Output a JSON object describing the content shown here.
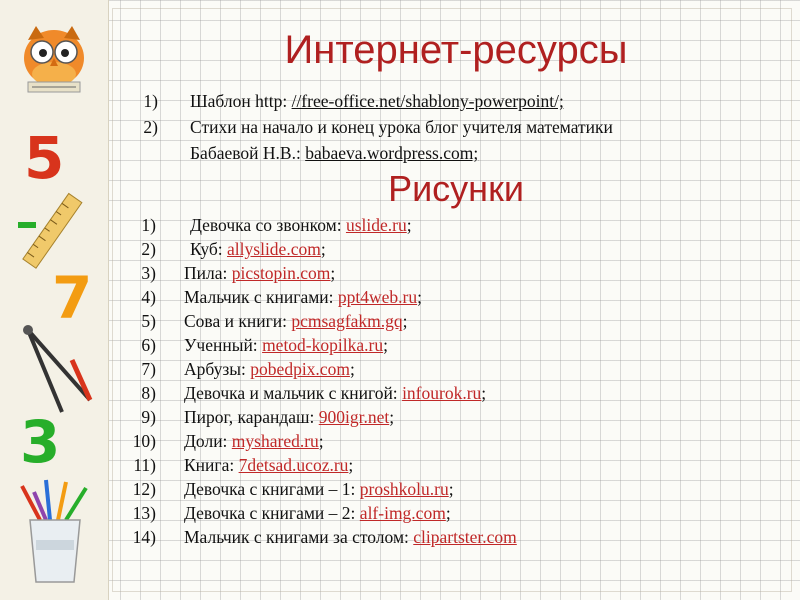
{
  "title": "Интернет-ресурсы",
  "resources": [
    {
      "num": "1)",
      "text": "Шаблон http: ",
      "link": "//free-office.net/shablony-powerpoint/;"
    },
    {
      "num": "2)",
      "text": "Стихи на начало и конец урока блог учителя математики",
      "cont": "Бабаевой Н.В.: ",
      "link": "babaeva.wordpress.com;"
    }
  ],
  "pictures_title": "Рисунки",
  "pictures": [
    {
      "num": "1)",
      "text": "Девочка со звонком: ",
      "link": "uslide.ru",
      "end": ";"
    },
    {
      "num": "2)",
      "text": "Куб:  ",
      "link": "allyslide.com",
      "end": ";"
    },
    {
      "num": "3)",
      "text": "Пила: ",
      "link": "picstopin.com",
      "end": ";"
    },
    {
      "num": "4)",
      "text": "Мальчик с книгами: ",
      "link": "ppt4web.ru",
      "end": ";"
    },
    {
      "num": "5)",
      "text": "Сова и книги: ",
      "link": "pcmsagfakm.gq",
      "end": ";"
    },
    {
      "num": "6)",
      "text": "Ученный: ",
      "link": "metod-kopilka.ru",
      "end": ";"
    },
    {
      "num": "7)",
      "text": "Арбузы: ",
      "link": "pobedpix.com",
      "end": ";"
    },
    {
      "num": "8)",
      "text": "Девочка и мальчик с книгой: ",
      "link": "infourok.ru",
      "end": ";"
    },
    {
      "num": "9)",
      "text": "Пирог, карандаш: ",
      "link": "900igr.net",
      "end": ";"
    },
    {
      "num": "10)",
      "text": "Доли: ",
      "link": "myshared.ru",
      "end": ";"
    },
    {
      "num": "11)",
      "text": "Книга: ",
      "link": "7detsad.ucoz.ru",
      "end": ";"
    },
    {
      "num": "12)",
      "text": "Девочка с книгами – 1:  ",
      "link": "proshkolu.ru",
      "end": ";"
    },
    {
      "num": "13)",
      "text": "Девочка с книгами – 2: ",
      "link": "alf-img.com",
      "end": ";"
    },
    {
      "num": "14)",
      "text": "Мальчик с книгами за столом: ",
      "link": "clipartster.com",
      "end": ""
    }
  ],
  "sidebar_digits": [
    "5",
    "7",
    "3"
  ],
  "colors": {
    "title": "#b02020",
    "link": "#c02828",
    "digit_red": "#d8341c",
    "digit_orange": "#f39c12",
    "digit_green": "#27ae2a"
  }
}
